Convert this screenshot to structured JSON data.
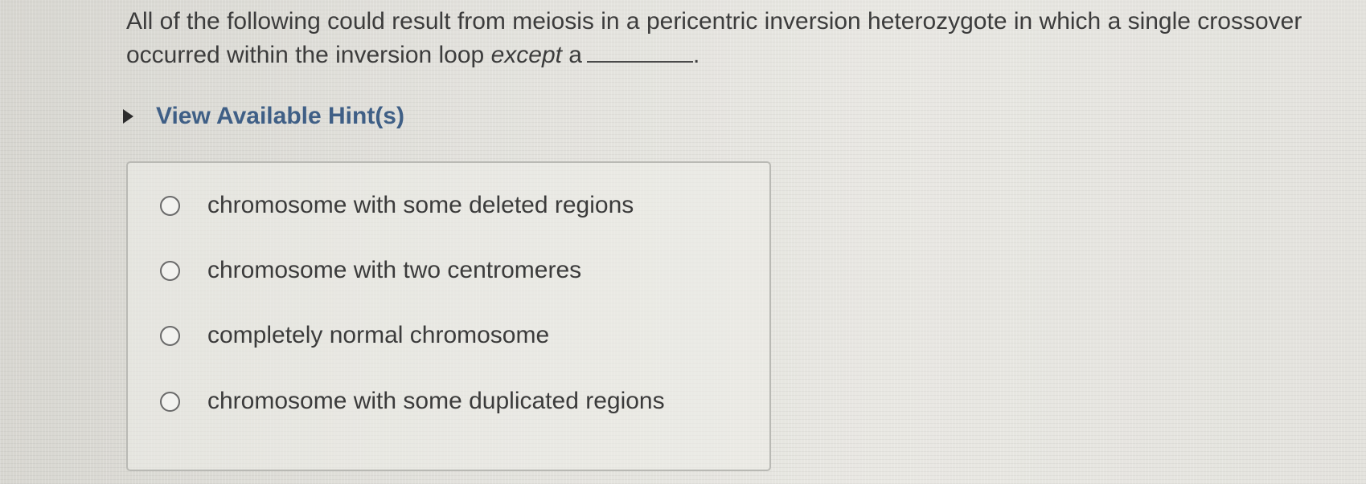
{
  "question": {
    "text_part1": "All of the following could result from meiosis in a pericentric inversion heterozygote in which a single crossover occurred within the inversion loop ",
    "text_emphasis": "except",
    "text_part2": " a",
    "blank_suffix": "."
  },
  "hint": {
    "label": "View Available Hint(s)",
    "icon": "disclosure-triangle-right-icon"
  },
  "options": [
    {
      "label": "chromosome with some deleted regions",
      "selected": false
    },
    {
      "label": "chromosome with two centromeres",
      "selected": false
    },
    {
      "label": "completely normal chromosome",
      "selected": false
    },
    {
      "label": "chromosome with some duplicated regions",
      "selected": false
    }
  ],
  "colors": {
    "hint_text": "#3f5f86",
    "body_text": "#3b3b3b",
    "box_border": "#b9b9b4",
    "radio_border": "#6a6a6a"
  }
}
